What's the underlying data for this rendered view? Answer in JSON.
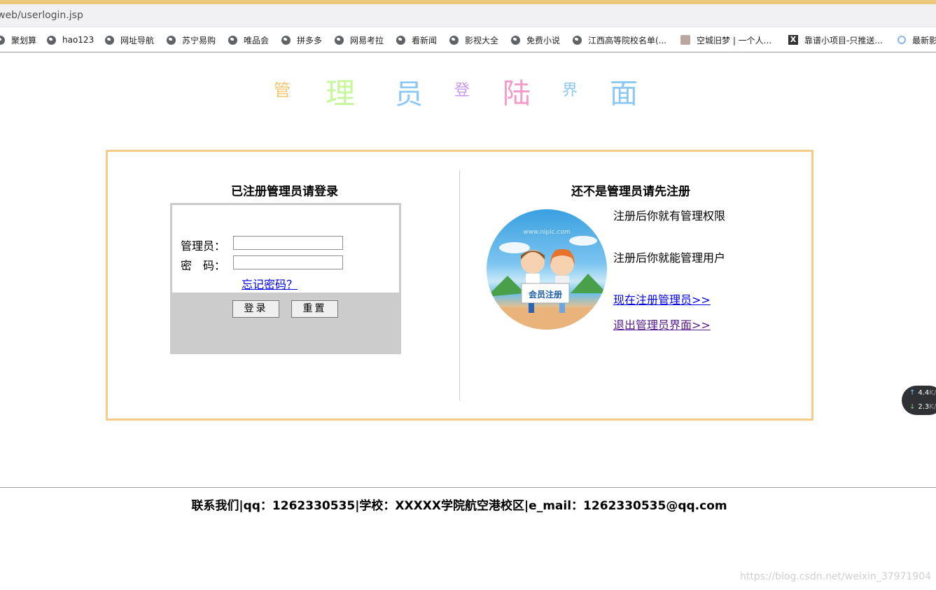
{
  "browser": {
    "url": "web/userlogin.jsp",
    "bookmarks": [
      "聚划算",
      "hao123",
      "网址导航",
      "苏宁易购",
      "唯品会",
      "拼多多",
      "网易考拉",
      "看新闻",
      "影视大全",
      "免费小说",
      "江西高等院校名单(...",
      "空城旧梦 | 一个人...",
      "靠谱小项目-只推送...",
      "最新影"
    ]
  },
  "page_title": {
    "chars": [
      "管",
      "理",
      "员",
      "登",
      "陆",
      "界",
      "面"
    ],
    "colors": [
      "#f7c36e",
      "#c6f79a",
      "#8cc8f4",
      "#c898f0",
      "#f49ac8",
      "#8cc8f4",
      "#8cc8f4"
    ]
  },
  "login": {
    "heading": "已注册管理员请登录",
    "username_label": "管理员：",
    "username_value": "",
    "password_label": "密　码：",
    "password_value": "",
    "forgot_link": "忘记密码？",
    "login_button": "登录",
    "reset_button": "重置"
  },
  "register": {
    "heading": "还不是管理员请先注册",
    "image_caption": "会员注册",
    "image_watermark": "www.nipic.com",
    "line1": "注册后你就有管理权限",
    "line2": "注册后你就能管理用户",
    "register_link": "现在注册管理员>>",
    "exit_link": "退出管理员界面>>"
  },
  "footer": {
    "contact": "联系我们|qq：1262330535|学校：XXXXX学院航空港校区|e_mail：1262330535@qq.com"
  },
  "speed_widget": {
    "upload": "4.4",
    "upload_unit": "K/s",
    "download": "2.3",
    "download_unit": "K/s"
  },
  "watermark": "https://blog.csdn.net/weixin_37971904",
  "colors": {
    "panel_border": "#f7cc8a",
    "link": "#0000ee",
    "visited_link": "#551a8b",
    "box_gray": "#cccccc"
  }
}
